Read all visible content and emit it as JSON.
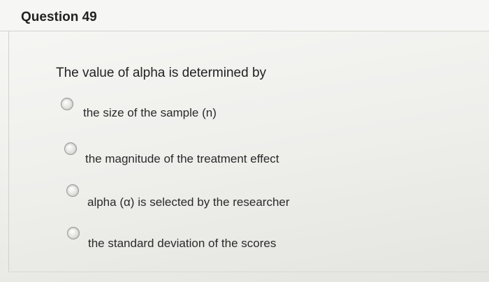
{
  "question": {
    "title": "Question 49",
    "prompt": "The value of alpha is determined by",
    "options": [
      {
        "label": "the size of the sample (n)",
        "selected": false
      },
      {
        "label": "the magnitude of the treatment effect",
        "selected": false
      },
      {
        "label": "alpha (α) is selected by the researcher",
        "selected": false
      },
      {
        "label": "the standard deviation of the scores",
        "selected": false
      }
    ]
  }
}
